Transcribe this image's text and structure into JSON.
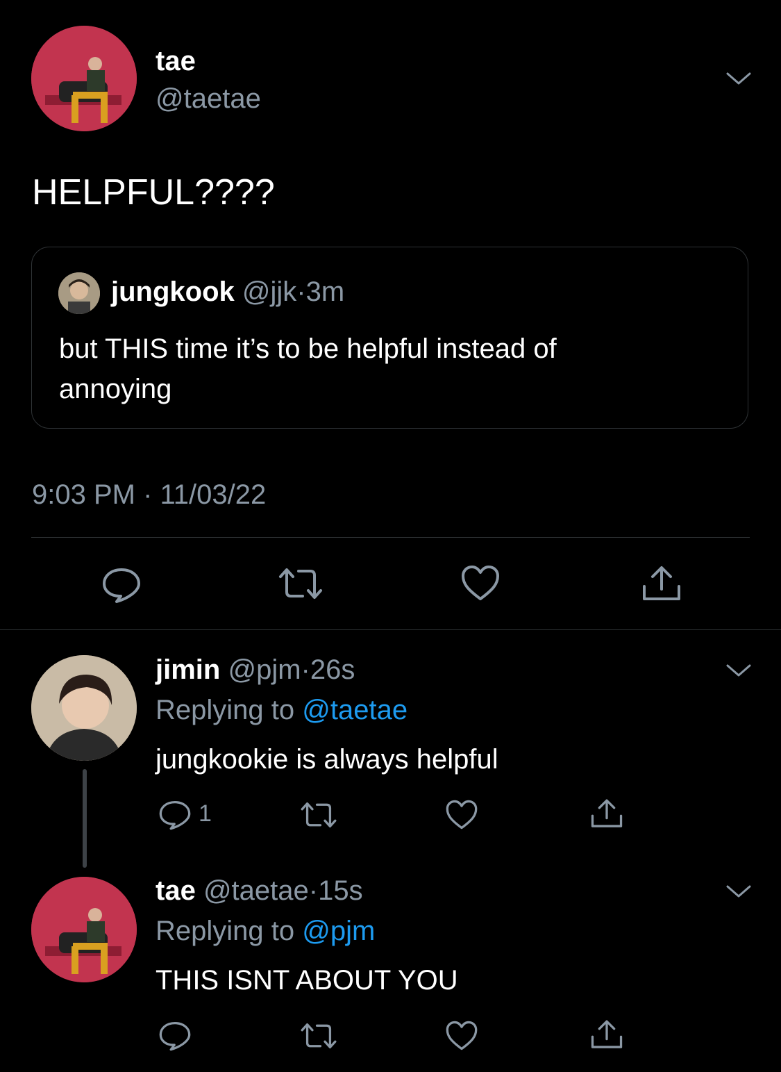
{
  "main_tweet": {
    "display_name": "tae",
    "handle": "@taetae",
    "text": "HELPFUL????",
    "quoted": {
      "display_name": "jungkook",
      "handle": "@jjk",
      "separator": "·",
      "time": "3m",
      "text_line1": "but THIS time it’s to be helpful instead of",
      "text_line2": "annoying"
    },
    "timestamp": "9:03 PM · 11/03/22"
  },
  "replies": [
    {
      "display_name": "jimin",
      "handle": "@pjm",
      "separator": "·",
      "time": "26s",
      "replying_prefix": "Replying to",
      "replying_handle": "@taetae",
      "text": "jungkookie is always helpful",
      "reply_count": "1"
    },
    {
      "display_name": "tae",
      "handle": "@taetae",
      "separator": "·",
      "time": "15s",
      "replying_prefix": "Replying to",
      "replying_handle": "@pjm",
      "text": "THIS ISNT ABOUT YOU",
      "reply_count": ""
    }
  ],
  "icons": {
    "reply": "reply-icon",
    "retweet": "retweet-icon",
    "like": "heart-icon",
    "share": "share-icon",
    "more": "chevron-down-icon"
  },
  "colors": {
    "background": "#000000",
    "text": "#ffffff",
    "muted": "#8b98a5",
    "link": "#1d9bf0",
    "avatar_tae": "#c2344f",
    "border": "#2f3336"
  }
}
